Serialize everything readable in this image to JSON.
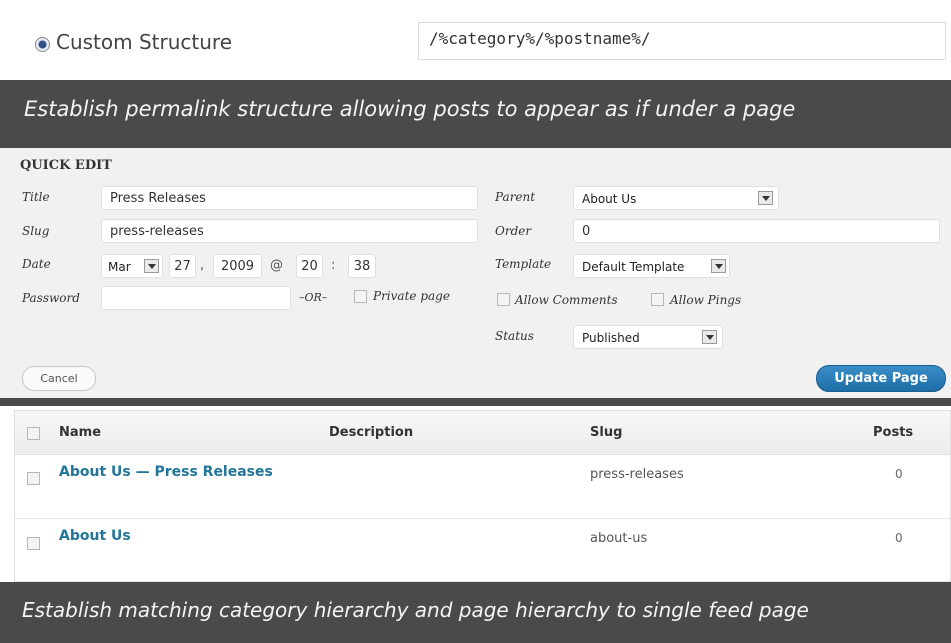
{
  "permalink": {
    "option_label": "Custom Structure",
    "structure_value": "/%category%/%postname%/"
  },
  "banners": {
    "top": "Establish permalink structure allowing posts to appear as if under a page",
    "bottom": "Establish matching category hierarchy and page hierarchy to single feed page"
  },
  "quick_edit": {
    "heading": "QUICK EDIT",
    "title_label": "Title",
    "title_value": "Press Releases",
    "slug_label": "Slug",
    "slug_value": "press-releases",
    "date_label": "Date",
    "date_month": "Mar",
    "date_day": "27",
    "date_year": "2009",
    "date_hour": "20",
    "date_minute": "38",
    "date_comma": ",",
    "date_at": "@",
    "date_colon": ":",
    "password_label": "Password",
    "password_value": "",
    "or_text": "–OR–",
    "private_label": "Private page",
    "parent_label": "Parent",
    "parent_value": "About Us",
    "order_label": "Order",
    "order_value": "0",
    "template_label": "Template",
    "template_value": "Default Template",
    "allow_comments_label": "Allow Comments",
    "allow_pings_label": "Allow Pings",
    "status_label": "Status",
    "status_value": "Published",
    "cancel_label": "Cancel",
    "update_label": "Update Page"
  },
  "table": {
    "columns": [
      "Name",
      "Description",
      "Slug",
      "Posts"
    ],
    "rows": [
      {
        "name": "About Us — Press Releases",
        "description": "",
        "slug": "press-releases",
        "posts": "0"
      },
      {
        "name": "About Us",
        "description": "",
        "slug": "about-us",
        "posts": "0"
      }
    ]
  },
  "colors": {
    "banner_bg": "#4a4a4a",
    "link": "#21759b",
    "primary_button": "#2a80bd"
  }
}
